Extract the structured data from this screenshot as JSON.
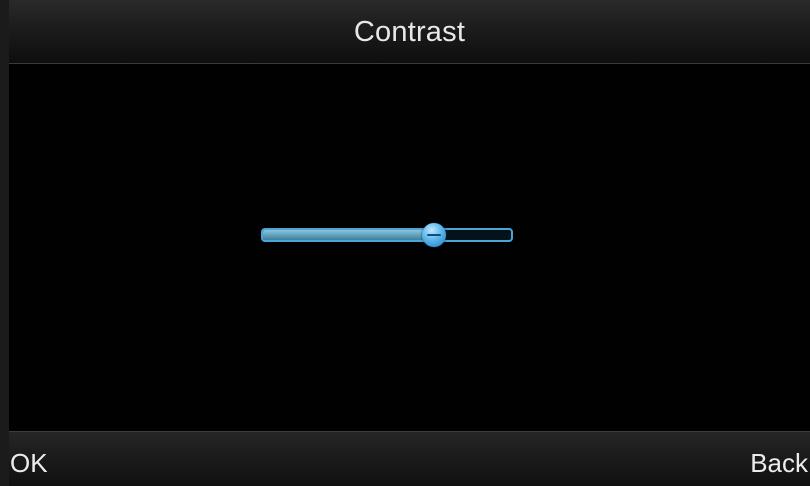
{
  "screen": {
    "title": "Contrast"
  },
  "contrast_slider": {
    "value_fraction": 0.69,
    "track_color": "#4aa6d6",
    "fill_color": "#6aaac8",
    "thumb_color": "#5cb6ea"
  },
  "soft_keys": {
    "left_label": "OK",
    "right_label": "Back"
  }
}
